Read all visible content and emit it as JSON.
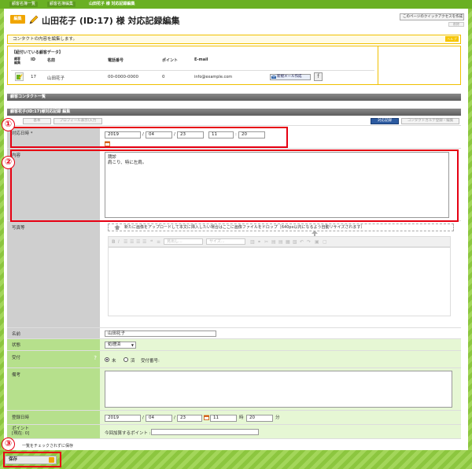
{
  "breadcrumb": [
    "顧客名簿一覧",
    "顧客名簿編集",
    "山田花子 様 対応記録編集"
  ],
  "header": {
    "tag": "編集",
    "title": "山田花子 (ID:17) 様 対応記録編集",
    "quick_access": "このページのクイックアクセスを作成",
    "delete_label": "削除"
  },
  "info": {
    "text": "コンタクトの内容を編集します。",
    "help": "ヘルプ"
  },
  "linked": {
    "title": "【紐付いている顧客データ】",
    "headers": [
      "顧客\n編集",
      "ID",
      "名前",
      "電話番号",
      "ポイント",
      "E-mail"
    ],
    "id": "17",
    "name": "山田花子",
    "phone": "00-0000-0000",
    "points": "0",
    "email": "info@example.com",
    "mail_button": "新規メール作成",
    "fb_icon": "f"
  },
  "section_bar_1": "顧客コンタクト一覧",
  "section_bar_2": "顧客花子(ID:17)様対応記録 編集",
  "toolbar": {
    "basic": "基本",
    "profile": "プロフィール表示/入力",
    "record": "対応記録",
    "contact_cat": "コンタクトカルテ登録・編集"
  },
  "fields": {
    "datetime_label": "対応日時 *",
    "date_y": "2019",
    "date_m": "04",
    "date_d": "23",
    "time_h": "11",
    "time_m": "20",
    "content_label": "内容",
    "content_line1": "競診",
    "content_line2": "肩こり、特に左肩。",
    "photo_label": "写真等",
    "dropzone_text": "新たに画像をアップロードして本文に挿入したい場合はここに画像ファイルをドロップ［640px以内になるよう自動リサイズされます］",
    "editor_heading": "見出し...",
    "editor_size": "サイズ...",
    "name_label": "名前",
    "name_value": "山田花子",
    "status_label": "状態",
    "status_value": "処理済",
    "reception_label": "受付",
    "reception_opt1": "未",
    "reception_opt2": "済",
    "reception_num": "受付番号:",
    "note_label": "備考",
    "reg_label": "登録日時",
    "reg_y": "2019",
    "reg_m": "04",
    "reg_d": "23",
    "reg_h": "11",
    "reg_min": "20",
    "reg_hour_unit": "時",
    "reg_min_unit": "分",
    "points_label": "ポイント",
    "points_current": "[現在: 0]",
    "points_add_label": "今回加算するポイント :",
    "footer_note": "一覧をチェックされずに保存"
  },
  "save_label": "保存",
  "markers": [
    "①",
    "②",
    "③"
  ],
  "colors": {
    "accent_green": "#8cc63f",
    "highlight_red": "#e60012",
    "tag_orange": "#f0a500"
  }
}
